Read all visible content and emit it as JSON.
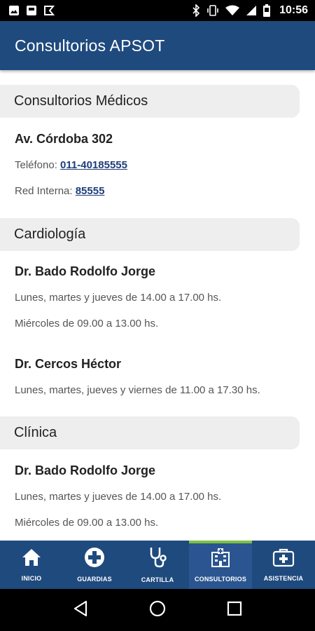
{
  "status_bar": {
    "time": "10:56",
    "left_icons": [
      "image-icon",
      "app-square-icon",
      "flipboard-icon"
    ],
    "right_icons": [
      "bluetooth-icon",
      "vibrate-icon",
      "wifi-icon",
      "signal-icon",
      "battery-icon"
    ]
  },
  "app_bar": {
    "title": "Consultorios APSOT"
  },
  "sections": {
    "medicos": {
      "title": "Consultorios Médicos",
      "address": "Av. Córdoba 302",
      "phone_label": "Teléfono: ",
      "phone": "011-40185555",
      "internal_label": "Red Interna: ",
      "internal": "85555"
    },
    "cardiologia": {
      "title": "Cardiología",
      "doctors": [
        {
          "name": "Dr. Bado Rodolfo Jorge",
          "lines": [
            "Lunes, martes y jueves de 14.00 a 17.00 hs.",
            "Miércoles de 09.00 a 13.00 hs."
          ]
        },
        {
          "name": "Dr. Cercos Héctor",
          "lines": [
            "Lunes, martes, jueves y viernes de 11.00 a 17.30 hs."
          ]
        }
      ]
    },
    "clinica": {
      "title": "Clínica",
      "doctors": [
        {
          "name": "Dr. Bado Rodolfo Jorge",
          "lines": [
            "Lunes, martes y jueves de 14.00 a 17.00 hs.",
            "Miércoles de 09.00 a 13.00 hs."
          ]
        }
      ]
    }
  },
  "bottom_nav": {
    "items": [
      {
        "label": "INICIO",
        "icon": "home-icon"
      },
      {
        "label": "GUARDIAS",
        "icon": "medical-cross-icon"
      },
      {
        "label": "CARTILLA",
        "icon": "stethoscope-icon"
      },
      {
        "label": "CONSULTORIOS",
        "icon": "hospital-building-icon",
        "active": true
      },
      {
        "label": "ASISTENCIA",
        "icon": "first-aid-kit-icon"
      }
    ]
  },
  "colors": {
    "primary": "#1f4a7e",
    "active_indicator": "#7dc242",
    "link": "#1f3d7a",
    "section_bg": "#eeeeee"
  }
}
